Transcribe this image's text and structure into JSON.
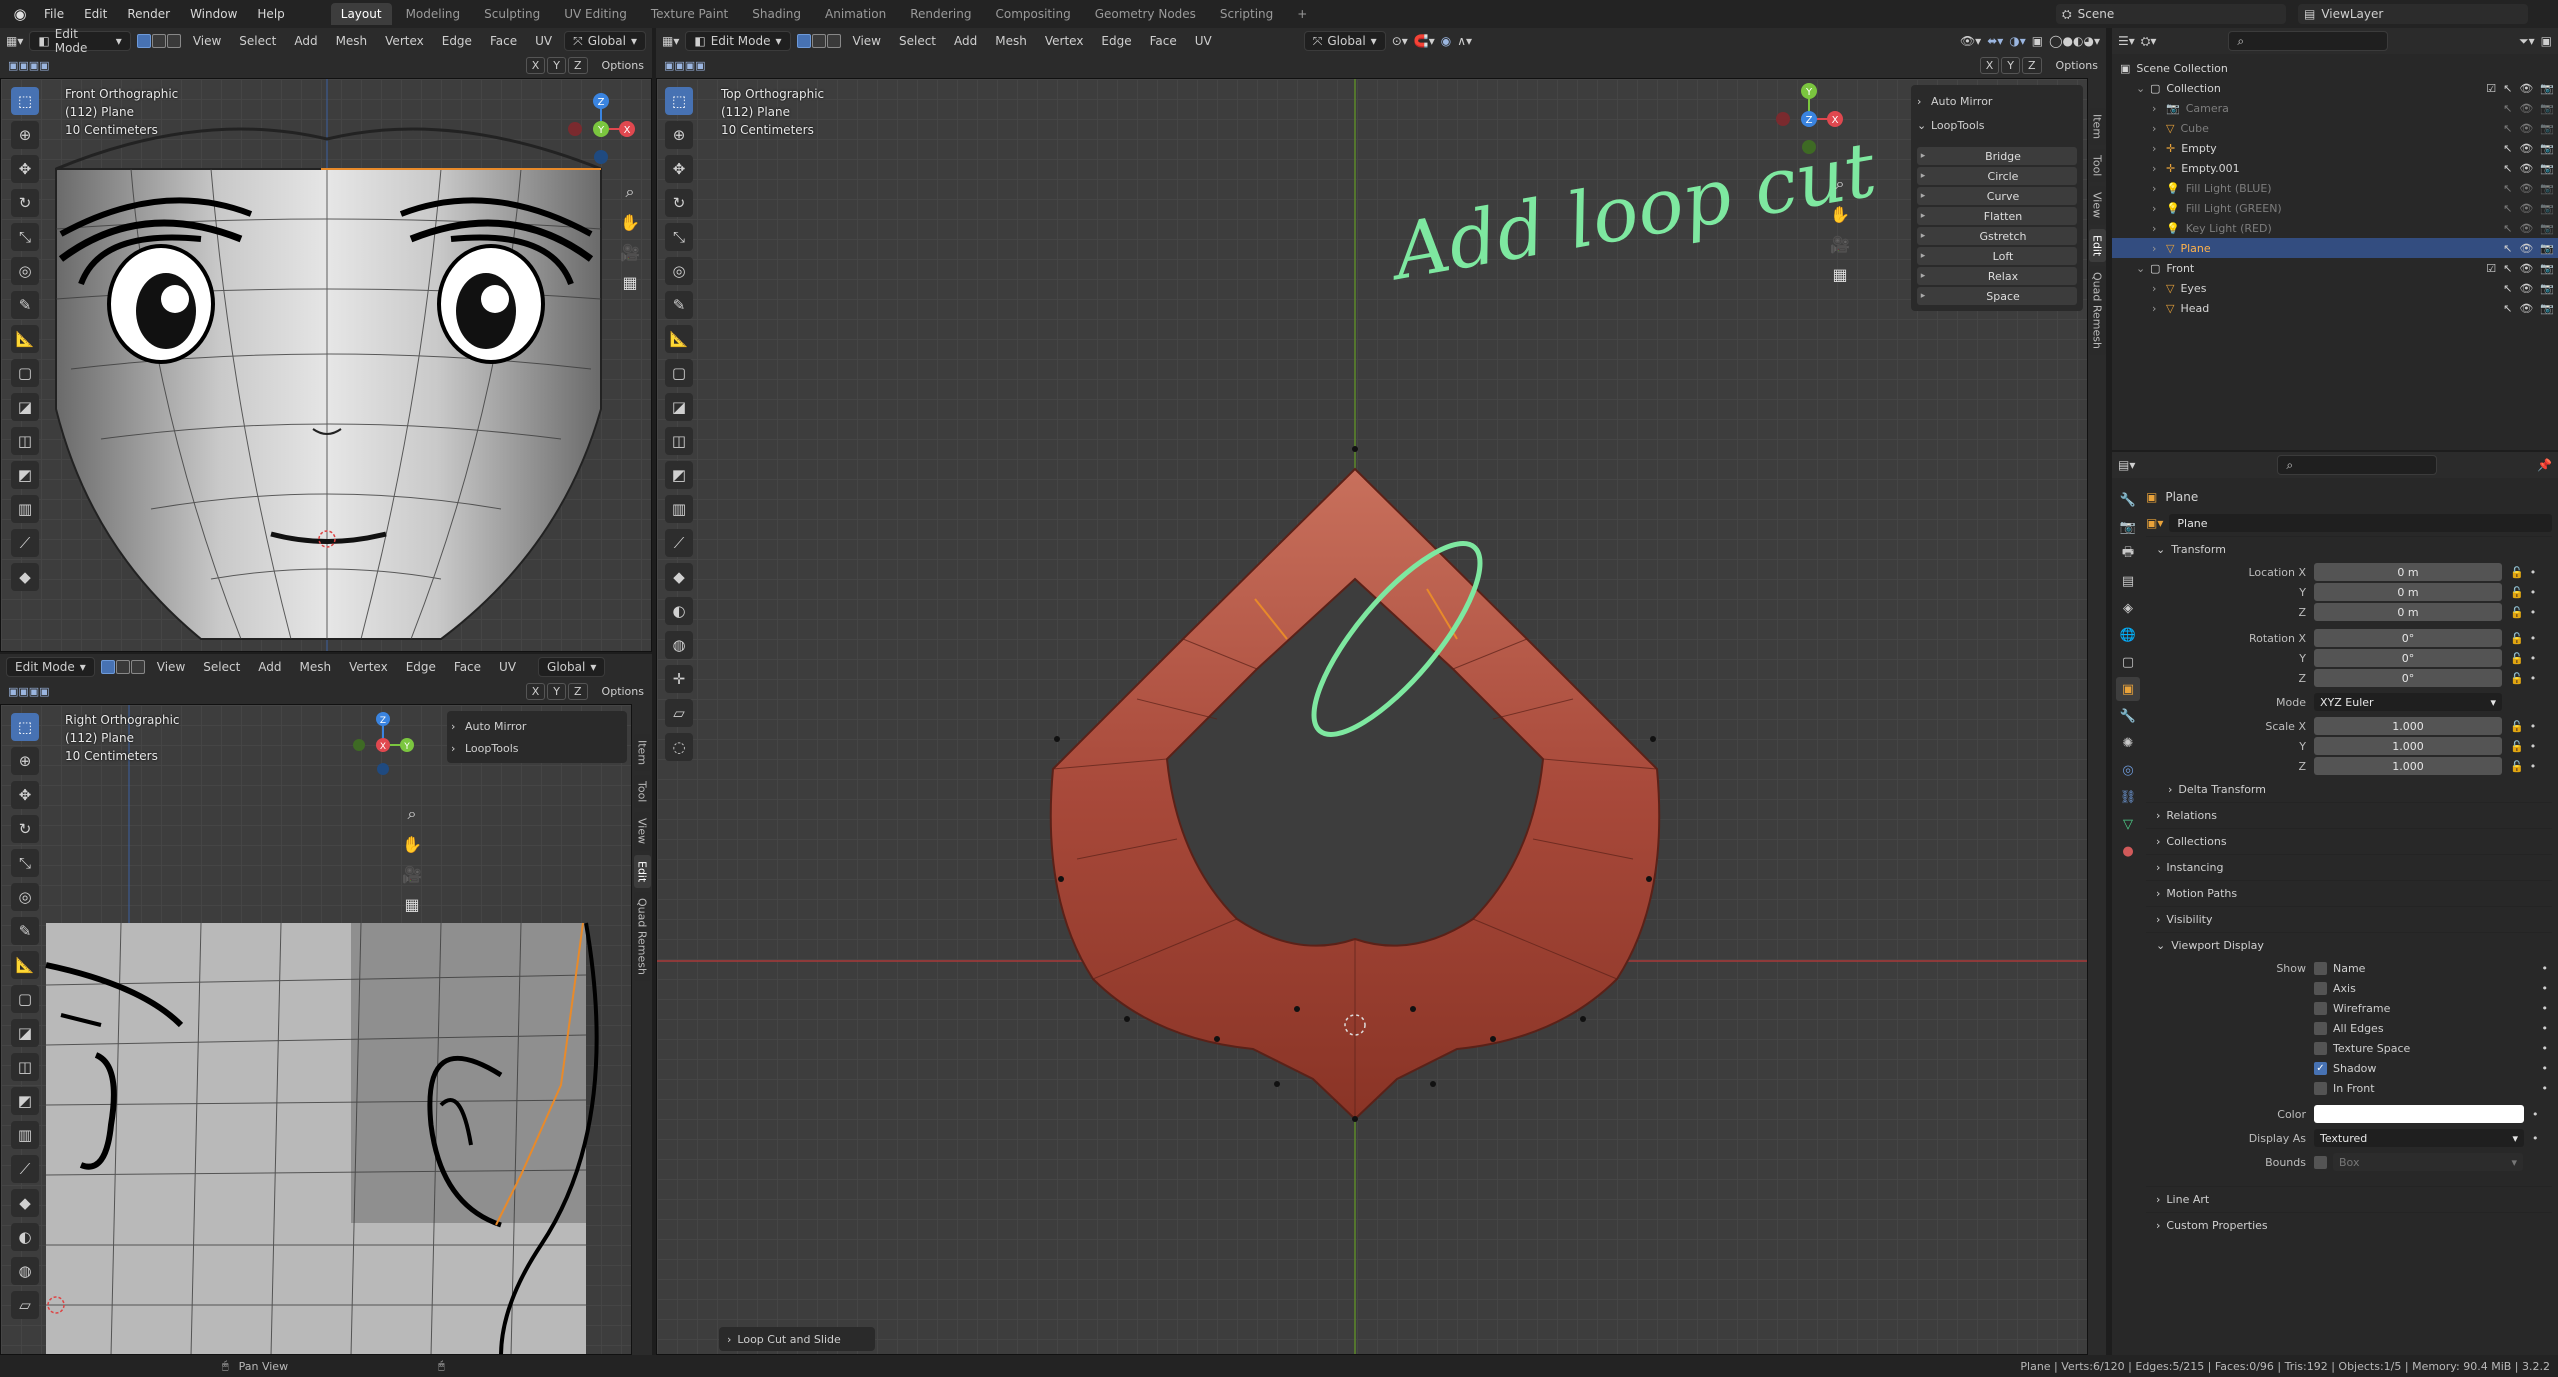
{
  "topbar": {
    "menus": [
      "File",
      "Edit",
      "Render",
      "Window",
      "Help"
    ],
    "workspaces": [
      "Layout",
      "Modeling",
      "Sculpting",
      "UV Editing",
      "Texture Paint",
      "Shading",
      "Animation",
      "Rendering",
      "Compositing",
      "Geometry Nodes",
      "Scripting"
    ],
    "active_workspace": "Layout",
    "add_tab": "+",
    "scene": "Scene",
    "view_layer": "ViewLayer"
  },
  "editor": {
    "mode": "Edit Mode",
    "menus": [
      "View",
      "Select",
      "Add",
      "Mesh",
      "Vertex",
      "Edge",
      "Face",
      "UV"
    ],
    "orientation": "Global",
    "options": "Options",
    "axes": [
      "X",
      "Y",
      "Z"
    ]
  },
  "vp_front": {
    "line1": "Front Orthographic",
    "line2": "(112) Plane",
    "line3": "10 Centimeters"
  },
  "vp_right": {
    "line1": "Right Orthographic",
    "line2": "(112) Plane",
    "line3": "10 Centimeters"
  },
  "vp_top": {
    "line1": "Top Orthographic",
    "line2": "(112) Plane",
    "line3": "10 Centimeters"
  },
  "side_panels": {
    "auto_mirror": "Auto Mirror",
    "looptools": "LoopTools"
  },
  "looptools_buttons": [
    "Bridge",
    "Circle",
    "Curve",
    "Flatten",
    "Gstretch",
    "Loft",
    "Relax",
    "Space"
  ],
  "n_tabs": [
    "Item",
    "Tool",
    "View",
    "Edit",
    "Quad Remesh"
  ],
  "annotation": "Add loop cut",
  "last_op": "Loop Cut and Slide",
  "gizmo": {
    "x": "X",
    "y": "Y",
    "z": "Z"
  },
  "outliner": {
    "scene_collection": "Scene Collection",
    "rows": [
      {
        "name": "Collection",
        "indent": 1,
        "dim": false,
        "sel": false,
        "kind": "coll"
      },
      {
        "name": "Camera",
        "indent": 2,
        "dim": true,
        "sel": false,
        "kind": "cam"
      },
      {
        "name": "Cube",
        "indent": 2,
        "dim": true,
        "sel": false,
        "kind": "mesh"
      },
      {
        "name": "Empty",
        "indent": 2,
        "dim": false,
        "sel": false,
        "kind": "empty"
      },
      {
        "name": "Empty.001",
        "indent": 2,
        "dim": false,
        "sel": false,
        "kind": "empty"
      },
      {
        "name": "Fill Light (BLUE)",
        "indent": 2,
        "dim": true,
        "sel": false,
        "kind": "light"
      },
      {
        "name": "Fill Light (GREEN)",
        "indent": 2,
        "dim": true,
        "sel": false,
        "kind": "light"
      },
      {
        "name": "Key Light (RED)",
        "indent": 2,
        "dim": true,
        "sel": false,
        "kind": "light"
      },
      {
        "name": "Plane",
        "indent": 2,
        "dim": false,
        "sel": true,
        "kind": "mesh"
      },
      {
        "name": "Front",
        "indent": 1,
        "dim": false,
        "sel": false,
        "kind": "coll"
      },
      {
        "name": "Eyes",
        "indent": 2,
        "dim": false,
        "sel": false,
        "kind": "mesh"
      },
      {
        "name": "Head",
        "indent": 2,
        "dim": false,
        "sel": false,
        "kind": "mesh"
      }
    ]
  },
  "properties": {
    "object_name": "Plane",
    "datablock": "Plane",
    "transform_title": "Transform",
    "location_x_label": "Location X",
    "location_x": "0 m",
    "y_label": "Y",
    "location_y": "0 m",
    "z_label": "Z",
    "location_z": "0 m",
    "rotation_x_label": "Rotation X",
    "rotation_x": "0°",
    "rotation_y": "0°",
    "rotation_z": "0°",
    "mode_label": "Mode",
    "mode": "XYZ Euler",
    "scale_x_label": "Scale X",
    "scale_x": "1.000",
    "scale_y": "1.000",
    "scale_z": "1.000",
    "delta_transform": "Delta Transform",
    "relations": "Relations",
    "collections": "Collections",
    "instancing": "Instancing",
    "motion_paths": "Motion Paths",
    "visibility": "Visibility",
    "viewport_display": "Viewport Display",
    "show_label": "Show",
    "show_items": [
      {
        "label": "Name",
        "checked": false
      },
      {
        "label": "Axis",
        "checked": false
      },
      {
        "label": "Wireframe",
        "checked": false
      },
      {
        "label": "All Edges",
        "checked": false
      },
      {
        "label": "Texture Space",
        "checked": false
      },
      {
        "label": "Shadow",
        "checked": true
      },
      {
        "label": "In Front",
        "checked": false
      }
    ],
    "color_label": "Color",
    "display_as_label": "Display As",
    "display_as": "Textured",
    "bounds_label": "Bounds",
    "bounds": "Box",
    "line_art": "Line Art",
    "custom_properties": "Custom Properties"
  },
  "statusbar": {
    "pan_view": "Pan View",
    "stats": "Plane | Verts:6/120 | Edges:5/215 | Faces:0/96 | Tris:192 | Objects:1/5 | Memory: 90.4 MiB | 3.2.2"
  },
  "colors": {
    "accent": "#4772b3",
    "annotation": "#7ee8a0",
    "mesh": "#a8493a",
    "axis_x": "#e0484f",
    "axis_y": "#7bc63f",
    "axis_z": "#3a84e0"
  }
}
